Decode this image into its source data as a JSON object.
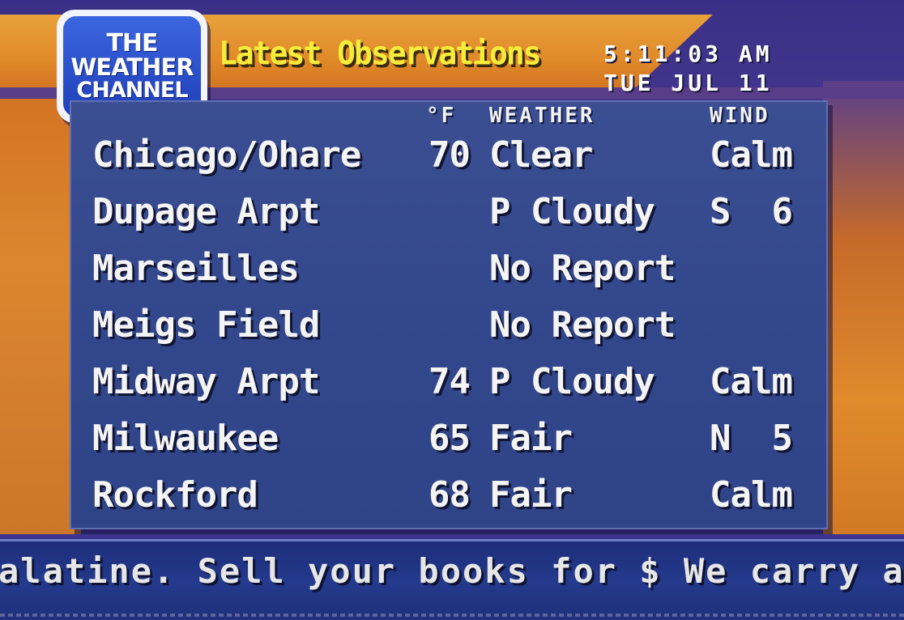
{
  "logo": {
    "line1": "THE",
    "line2": "WEATHER",
    "line3": "CHANNEL"
  },
  "header": {
    "title": "Latest Observations",
    "time": "5:11:03 AM",
    "date": "TUE JUL 11"
  },
  "columns": {
    "temp": "°F",
    "weather": "WEATHER",
    "wind": "WIND"
  },
  "observations": [
    {
      "city": "Chicago/Ohare",
      "temp": "70",
      "weather": "Clear",
      "wind": "Calm"
    },
    {
      "city": "Dupage Arpt",
      "temp": "",
      "weather": "P Cloudy",
      "wind": "S  6"
    },
    {
      "city": "Marseilles",
      "temp": "",
      "weather": "No Report",
      "wind": ""
    },
    {
      "city": "Meigs Field",
      "temp": "",
      "weather": "No Report",
      "wind": ""
    },
    {
      "city": "Midway Arpt",
      "temp": "74",
      "weather": "P Cloudy",
      "wind": "Calm"
    },
    {
      "city": "Milwaukee",
      "temp": "65",
      "weather": "Fair",
      "wind": "N  5"
    },
    {
      "city": "Rockford",
      "temp": "68",
      "weather": "Fair",
      "wind": "Calm"
    }
  ],
  "ticker": {
    "text": "alatine. Sell your books for $ We carry al"
  },
  "colors": {
    "title_yellow": "#f6ec3a",
    "panel_blue": "#33478c",
    "header_orange": "#e08a2a",
    "logo_blue": "#1f3fb8"
  }
}
